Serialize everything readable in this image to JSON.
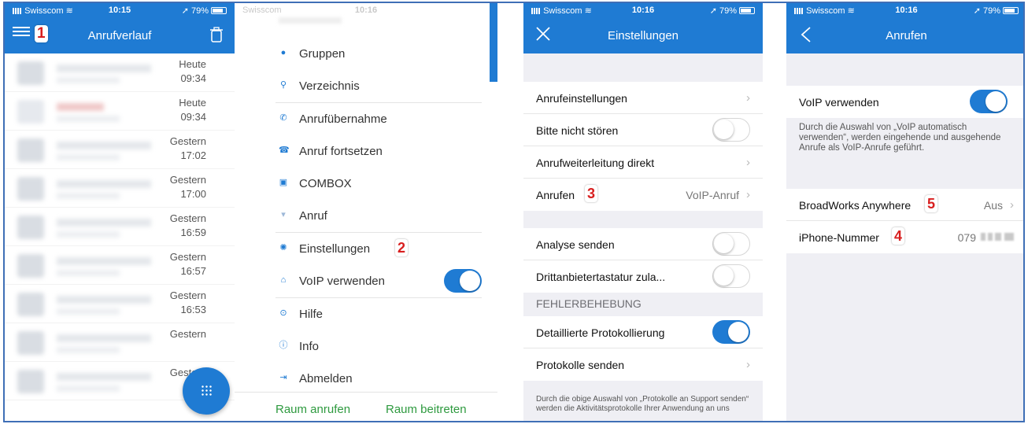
{
  "status_bar": {
    "carrier": "Swisscom",
    "battery": "79%",
    "time_1": "10:15",
    "time_2": "10:16"
  },
  "screen1": {
    "title": "Anrufverlauf",
    "badge": "1",
    "calls": [
      {
        "day": "Heute",
        "time": "09:34"
      },
      {
        "day": "Heute",
        "time": "09:34"
      },
      {
        "day": "Gestern",
        "time": "17:02"
      },
      {
        "day": "Gestern",
        "time": "17:00"
      },
      {
        "day": "Gestern",
        "time": "16:59"
      },
      {
        "day": "Gestern",
        "time": "16:57"
      },
      {
        "day": "Gestern",
        "time": "16:53"
      },
      {
        "day": "Gestern",
        "time": ""
      },
      {
        "day": "Gestern",
        "time": ""
      }
    ]
  },
  "screen2": {
    "menu": [
      {
        "icon": "groups-icon",
        "label": "Gruppen"
      },
      {
        "icon": "search-icon",
        "label": "Verzeichnis"
      },
      {
        "icon": "call-pickup-icon",
        "label": "Anrufübernahme"
      },
      {
        "icon": "call-resume-icon",
        "label": "Anruf fortsetzen"
      },
      {
        "icon": "combox-icon",
        "label": "COMBOX"
      },
      {
        "icon": "call-icon",
        "label": "Anruf"
      },
      {
        "icon": "settings-icon",
        "label": "Einstellungen",
        "badge": "2"
      },
      {
        "icon": "voip-icon",
        "label": "VoIP verwenden",
        "toggle": true
      },
      {
        "icon": "help-icon",
        "label": "Hilfe"
      },
      {
        "icon": "info-icon",
        "label": "Info"
      },
      {
        "icon": "logout-icon",
        "label": "Abmelden"
      }
    ],
    "footer_left": "Raum anrufen",
    "footer_right": "Raum beitreten"
  },
  "screen3": {
    "title": "Einstellungen",
    "rows": {
      "anrufeinstellungen": "Anrufeinstellungen",
      "bitte_nicht_stoeren": "Bitte nicht stören",
      "weiterleitung": "Anrufweiterleitung direkt",
      "anrufen": "Anrufen",
      "anrufen_badge": "3",
      "anrufen_value": "VoIP-Anruf",
      "analyse": "Analyse senden",
      "drittanbieter": "Drittanbietertastatur zula...",
      "protokollierung": "Detaillierte Protokollierung",
      "protokolle_senden": "Protokolle senden"
    },
    "section_fehler": "FEHLERBEHEBUNG",
    "footer_text": "Durch die obige Auswahl von „Protokolle an Support senden“ werden die Aktivitätsprotokolle Ihrer Anwendung an uns"
  },
  "screen4": {
    "title": "Anrufen",
    "voip_label": "VoIP verwenden",
    "voip_desc": "Durch die Auswahl von „VoIP automatisch verwenden“, werden eingehende und ausgehende Anrufe als VoIP-Anrufe geführt.",
    "broadworks": "BroadWorks Anywhere",
    "broadworks_badge": "5",
    "broadworks_value": "Aus",
    "iphone": "iPhone-Nummer",
    "iphone_badge": "4",
    "iphone_value": "079"
  },
  "colors": {
    "accent": "#1f7bd3",
    "annotation": "#d81f1f",
    "green_link": "#2e9a3f"
  }
}
